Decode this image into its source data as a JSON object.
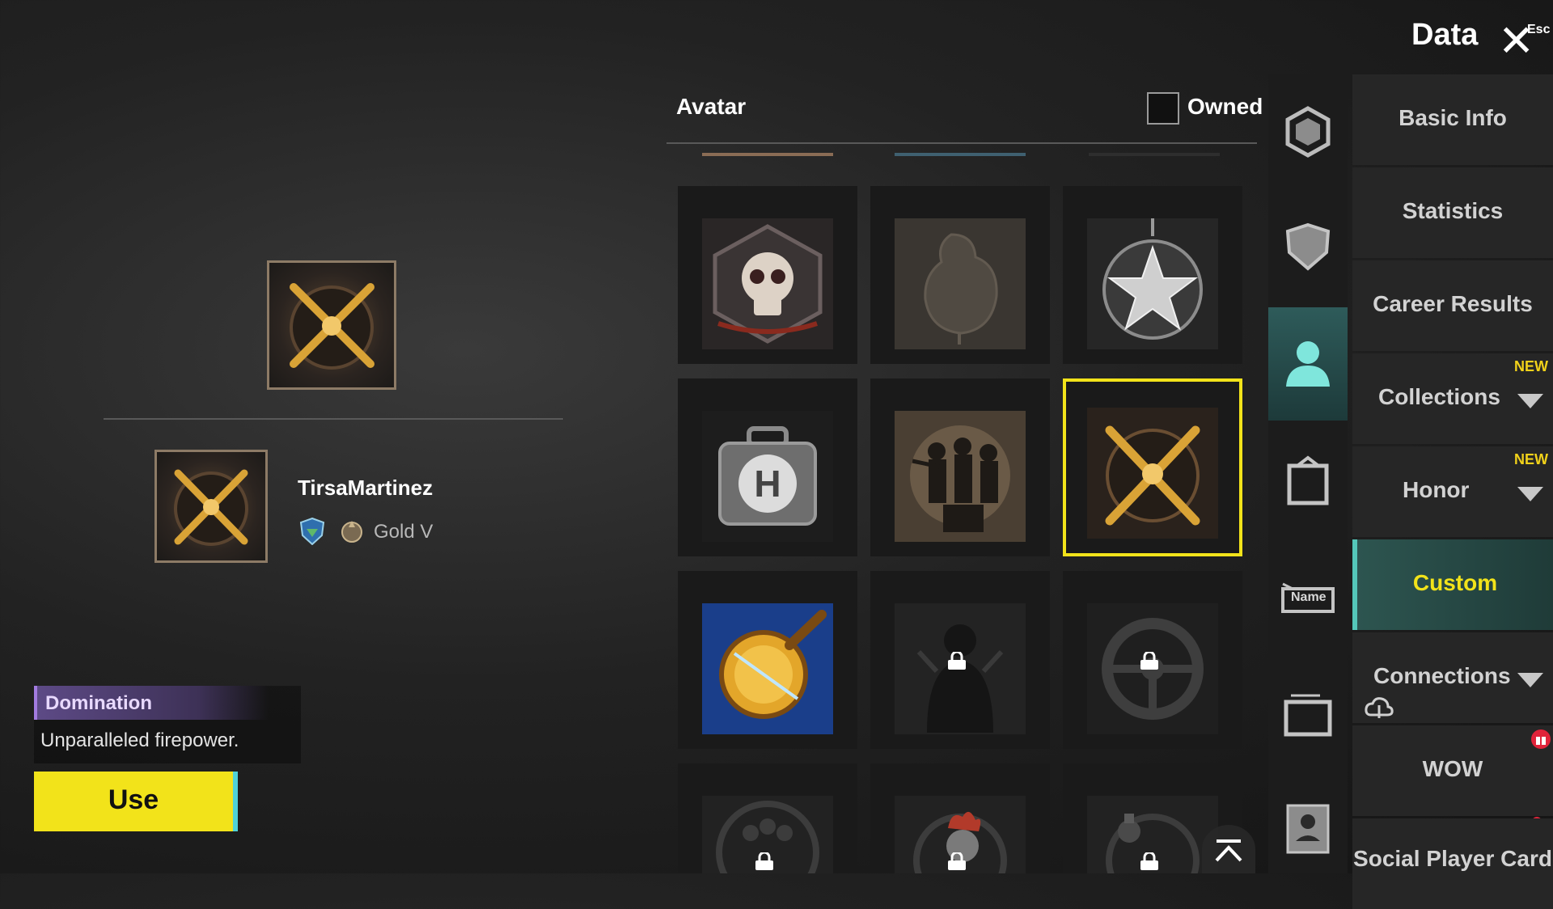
{
  "header": {
    "title": "Data",
    "close_hint": "Esc"
  },
  "profile": {
    "player_name": "TirsaMartinez",
    "rank": "Gold V",
    "selected_avatar": {
      "title": "Domination",
      "description": "Unparalleled firepower."
    },
    "use_button": "Use"
  },
  "avatar_panel": {
    "label": "Avatar",
    "owned_filter": "Owned",
    "tiles": [
      {
        "icon": "skull-hexagon-icon",
        "locked": false
      },
      {
        "icon": "chicken-silhouette-icon",
        "locked": false
      },
      {
        "icon": "star-medal-icon",
        "locked": false
      },
      {
        "icon": "medkit-icon",
        "locked": false
      },
      {
        "icon": "squad-soldiers-icon",
        "locked": false
      },
      {
        "icon": "crossed-rifles-pan-icon",
        "locked": false,
        "selected": true
      },
      {
        "icon": "frying-pan-icon",
        "locked": false
      },
      {
        "icon": "gunslinger-icon",
        "locked": true
      },
      {
        "icon": "steering-wheel-icon",
        "locked": true
      },
      {
        "icon": "team-icon",
        "locked": true
      },
      {
        "icon": "rooster-icon",
        "locked": true
      },
      {
        "icon": "grenade-icon",
        "locked": true
      }
    ]
  },
  "side_icons": [
    "emblem-icon",
    "shield-icon",
    "avatar-person-icon",
    "frame-icon",
    "nameplate-icon",
    "card-frame-icon",
    "id-card-icon"
  ],
  "side_icon_labels": {
    "nameplate": "Name"
  },
  "menu": [
    {
      "label": "Basic Info",
      "new": false,
      "arrow": false
    },
    {
      "label": "Statistics",
      "new": false,
      "arrow": false
    },
    {
      "label": "Career Results",
      "new": false,
      "arrow": false
    },
    {
      "label": "Collections",
      "new": true,
      "arrow": true
    },
    {
      "label": "Honor",
      "new": true,
      "arrow": true
    },
    {
      "label": "Custom",
      "new": false,
      "arrow": false,
      "active": true
    },
    {
      "label": "Connections",
      "new": false,
      "arrow": true
    },
    {
      "label": "WOW",
      "new": false,
      "arrow": false
    },
    {
      "label": "Social Player Card",
      "new": false,
      "arrow": false
    }
  ],
  "new_badge": "NEW",
  "colors": {
    "accent_yellow": "#f2e31a",
    "accent_teal": "#54c7b9",
    "notice_red": "#e0233a"
  }
}
